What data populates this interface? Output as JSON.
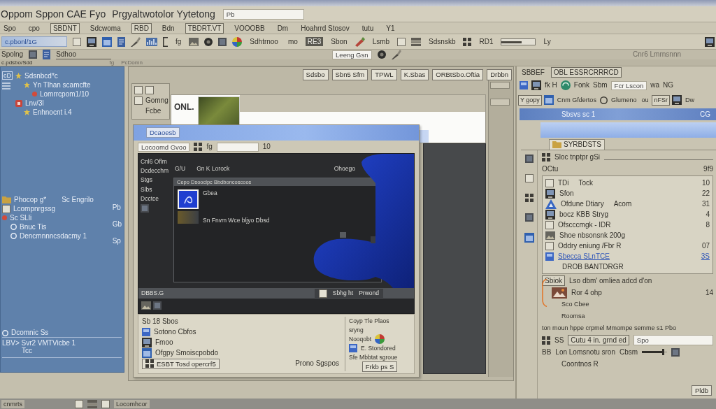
{
  "title_bar": {
    "title": "Oppom Sppon CAE Fyo",
    "subtitle": "Prgyaltwotolor Yytetong",
    "field_value": "Pb"
  },
  "menu": [
    {
      "label": "Spo",
      "boxed": false
    },
    {
      "label": "cpo",
      "boxed": false
    },
    {
      "label": "SBDNT",
      "boxed": true
    },
    {
      "label": "Sdcwoma",
      "boxed": false
    },
    {
      "label": "RBD",
      "boxed": true
    },
    {
      "label": "Bdn",
      "boxed": false
    },
    {
      "label": "TBDRT.VT",
      "boxed": true
    },
    {
      "label": "VOOOBB",
      "boxed": false
    },
    {
      "label": "Dm",
      "boxed": false
    },
    {
      "label": "Hoahrrd Stosov",
      "boxed": false
    },
    {
      "label": "tutu",
      "boxed": false
    },
    {
      "label": "Y1",
      "boxed": false
    }
  ],
  "toolbar": {
    "path_value": "c.pbonl/1G",
    "labels": [
      {
        "label": "fg",
        "boxed": false
      },
      {
        "label": "Sdhtrnoo",
        "boxed": false
      },
      {
        "label": "mo",
        "boxed": false
      },
      {
        "label": "RE3",
        "boxed": true
      },
      {
        "label": "Sbon",
        "boxed": false
      },
      {
        "label": "Lsmb",
        "boxed": false
      },
      {
        "label": "Sdsnskb",
        "boxed": false
      },
      {
        "label": "RD1",
        "boxed": false
      },
      {
        "label": "Ly",
        "boxed": false
      }
    ],
    "slider": {
      "level": 0.6
    }
  },
  "options_bar": {
    "labels": [
      "Spolng",
      "Sdhoo"
    ],
    "field_value": "Leeng Gsn",
    "status": "Cnr6 Lmrnsnnn"
  },
  "path_bar": {
    "labels": [
      "c.pdsbo/Sdd",
      "fg",
      "PcDomn"
    ]
  },
  "sidebar": {
    "tag": "cD",
    "groups": [
      {
        "items": [
          {
            "label": "Sdsnbcd*c",
            "children": [
              {
                "label": "Yn Tlhan scamcfte",
                "children": [
                  {
                    "label": "Lomrrcpom1/10"
                  }
                ]
              }
            ]
          },
          {
            "label": "Lnv/3l",
            "children": [
              {
                "label": "Enhnocnt i.4"
              }
            ]
          }
        ]
      },
      {
        "items": [
          {
            "label": "Phocop g*",
            "note": "Sc Engrilo"
          },
          {
            "label": "Lcompnrgssg"
          },
          {
            "label": "Sc SLli",
            "children": [
              {
                "label": "Bnuc Tis"
              },
              {
                "label": "Dencmnnncsdacmy 1"
              }
            ]
          }
        ]
      }
    ],
    "side_labels": [
      "Pb",
      "Gb",
      "Sp"
    ],
    "footer": [
      "Dcomnic Ss",
      "LBV> Svr2 VMTVicbe 1",
      "Tcc"
    ]
  },
  "back_window": {
    "tabs": [
      "Sdsbo",
      "Sbn5 Sfm",
      "TPWL",
      "K.Sbas",
      "ORBtSbo.Oftia",
      "Drbbn"
    ],
    "side_buttons": [
      "Gomng",
      "Fcbe"
    ]
  },
  "image_window": {
    "title": "ONL."
  },
  "editor_window": {
    "title": "Dcaoesb",
    "toolbar": [
      "Locoomd Gvoo",
      "fg",
      "10"
    ],
    "side_labels": [
      "Cnl6 Oflm",
      "Dcdecchm",
      "Stgs",
      "Slbs",
      "Dcctce"
    ],
    "header_labels": [
      "G/U",
      "Gn K Lorock",
      "Ohoego"
    ],
    "preview": {
      "title": "Cepo Dsooclpc Bbdboncoscoos",
      "caption": "Gbea",
      "text": "Sn Fnvm Wce bljyo Dbsd"
    },
    "status": {
      "left": "DBBS.G",
      "right": [
        "Sbhg ht",
        "Prwond"
      ]
    },
    "options": [
      "Sb 18 Sbos",
      "Sotono Cbfos",
      "Fmoo",
      "Ofgpy Smoiscpobdo"
    ],
    "action_button": "ESBT Tosd opercrf5",
    "note": "Prono Sgspos",
    "side_panel": {
      "lines": [
        "Coyp Tle Plaos",
        "sryng",
        "Nooqobt"
      ],
      "items": [
        "E. Stondored",
        "Sfe Mbbtat sgroue"
      ],
      "button": "Frkb ps S"
    }
  },
  "right_panel": {
    "header": [
      {
        "label": "SBBEF",
        "boxed": false
      },
      {
        "label": "OBL ESSRCRRRCD",
        "boxed": true
      }
    ],
    "toolbar": [
      "fk H",
      "Fonk",
      "Sbm"
    ],
    "toolbar_field": "Fcr Lscon",
    "toolbar_end": [
      "wa",
      "NG"
    ],
    "tools": [
      {
        "label": "Y gopy",
        "boxed": true
      },
      {
        "label": "Cnm Gfdertos",
        "boxed": false
      },
      {
        "label": "Glumeno",
        "boxed": false
      },
      {
        "label": "ou",
        "boxed": false
      },
      {
        "label": "nFSr",
        "boxed": true
      },
      {
        "label": "Dw",
        "boxed": false
      }
    ],
    "title": "Sbsvs sc 1",
    "title_badge": "CG",
    "tab": {
      "label": "SYRBDSTS",
      "selected": true
    },
    "search_label": "Sloc tnptpr gSi",
    "column_left": "OCtu",
    "column_right": "9f9",
    "rows": [
      {
        "name": "TDi",
        "note": "Tock",
        "value": "10",
        "selected": false
      },
      {
        "name": "Sfon",
        "value": "22",
        "selected": false
      },
      {
        "name": "Ofdune Dtiary",
        "note": "Acom",
        "value": "31",
        "selected": false
      },
      {
        "name": "bocz KBB Stryg",
        "value": "4",
        "selected": false
      },
      {
        "name": "Ofscccmgk - IDR",
        "value": "8",
        "selected": false
      },
      {
        "name": "Shoe nbsonsnk 200g",
        "selected": false
      },
      {
        "name": "Oddry eniung /Fbr R",
        "value": "07",
        "selected": false
      },
      {
        "name": "Sbecca SLnTCE",
        "value": "3S",
        "selected": true
      },
      {
        "name": "DROB BANTDRGR",
        "selected": false
      }
    ],
    "notice_label": "Sbiok",
    "notice": "Lso dbm' omliea adcd d'on",
    "entry": {
      "title": "Ror 4 ohp",
      "value": "14",
      "subtitle": "Sco Cbee"
    },
    "description_title": "Roomsa",
    "description": "ton moun hppe crpmel Mmompe semme s1 Pbo",
    "settings": [
      {
        "kind": "field",
        "tag": "SS",
        "label": "Cutu 4 in. grnd ed",
        "value": "Spo"
      },
      {
        "kind": "slider",
        "tag": "BB",
        "label": "Lon Lomsnotu sron",
        "reading": "Cbsm",
        "level": 0.85
      }
    ],
    "footer_label": "Coontnos R",
    "button": "Pldb"
  },
  "taskbar": {
    "labels": [
      "cnmrts",
      "Locomhcor"
    ]
  }
}
